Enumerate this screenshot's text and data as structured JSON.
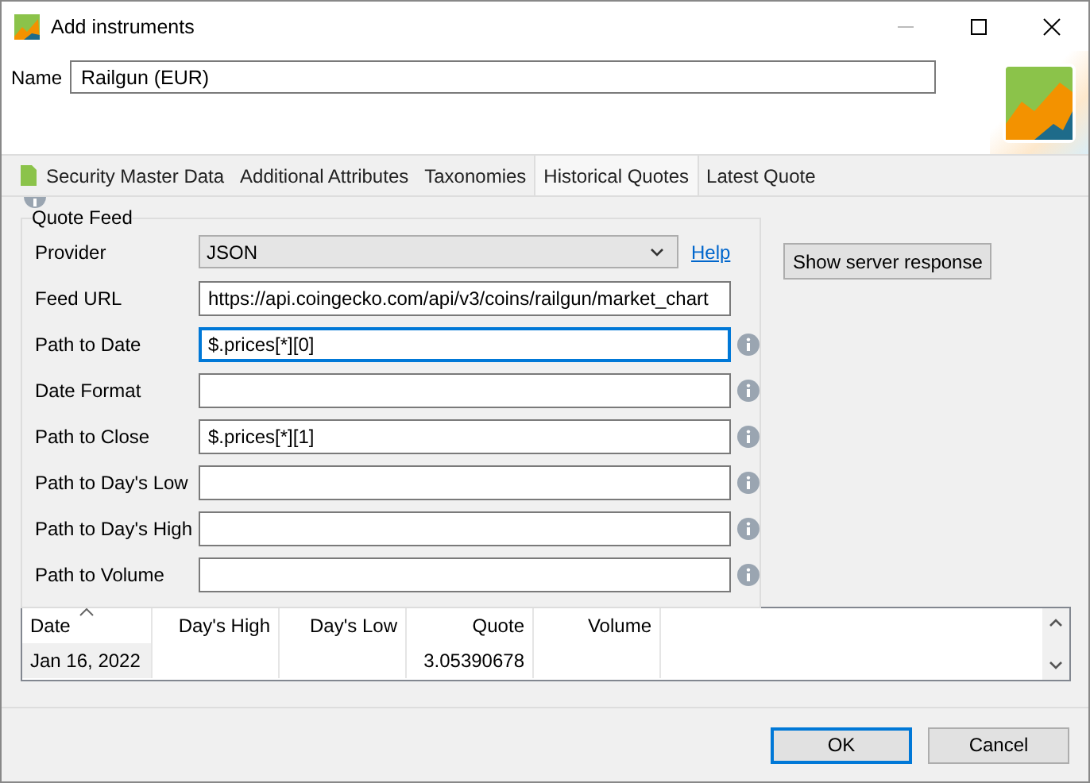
{
  "window": {
    "title": "Add instruments"
  },
  "name_field": {
    "label": "Name",
    "value": "Railgun (EUR)"
  },
  "tabs": [
    {
      "label": "Security Master Data",
      "selected": false,
      "icon": true
    },
    {
      "label": "Additional Attributes",
      "selected": false,
      "icon": false
    },
    {
      "label": "Taxonomies",
      "selected": false,
      "icon": false
    },
    {
      "label": "Historical Quotes",
      "selected": true,
      "icon": false
    },
    {
      "label": "Latest Quote",
      "selected": false,
      "icon": false
    }
  ],
  "quote_feed": {
    "title": "Quote Feed",
    "fields": [
      {
        "kind": "dropdown",
        "label": "Provider",
        "value": "JSON",
        "link": "Help"
      },
      {
        "kind": "text",
        "label": "Feed URL",
        "value": "https://api.coingecko.com/api/v3/coins/railgun/market_chart",
        "focused": false,
        "info": false
      },
      {
        "kind": "text",
        "label": "Path to Date",
        "value": "$.prices[*][0]",
        "focused": true,
        "info": true
      },
      {
        "kind": "text",
        "label": "Date Format",
        "focused": false,
        "info": true
      },
      {
        "kind": "text",
        "label": "Path to Close",
        "value": "$.prices[*][1]",
        "focused": false,
        "info": true
      },
      {
        "kind": "text",
        "label": "Path to Day's Low",
        "focused": false,
        "info": true
      },
      {
        "kind": "text",
        "label": "Path to Day's High",
        "focused": false,
        "info": true
      },
      {
        "kind": "text",
        "label": "Path to Volume",
        "focused": false,
        "info": true
      }
    ]
  },
  "show_response_button": "Show server response",
  "table": {
    "columns": [
      {
        "label": "Date",
        "sorted": true
      },
      {
        "label": "Day's High",
        "sorted": false
      },
      {
        "label": "Day's Low",
        "sorted": false
      },
      {
        "label": "Quote",
        "sorted": false
      },
      {
        "label": "Volume",
        "sorted": false
      }
    ],
    "rows": [
      [
        "Jan 16, 2022",
        null,
        null,
        "3.05390678",
        null
      ]
    ]
  },
  "buttons": [
    {
      "label": "OK",
      "default": true
    },
    {
      "label": "Cancel",
      "default": false
    }
  ]
}
